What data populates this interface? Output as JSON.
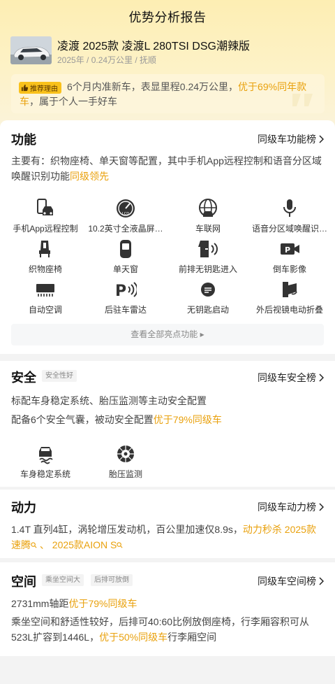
{
  "page": {
    "title": "优势分析报告"
  },
  "car": {
    "title": "凌渡 2025款 凌渡L 280TSI DSG潮辣版",
    "meta": "2025年 / 0.24万公里 / 抚顺"
  },
  "recommend": {
    "badge": "推荐理由",
    "text_1": "6个月内准新车，表显里程0.24万公里，",
    "highlight": "优于69%同年款车",
    "text_2": "，属于个人一手好车"
  },
  "features": {
    "title": "功能",
    "link": "同级车功能榜",
    "desc_1": "主要有：织物座椅、单天窗等配置，其中手机App远程控制和语音分区域唤醒识别功能",
    "desc_hl": "同级领先",
    "items": [
      {
        "label": "手机App远程控制",
        "icon": "phone-car-icon"
      },
      {
        "label": "10.2英寸全液晶屏…",
        "icon": "lcd-gauge-icon"
      },
      {
        "label": "车联网",
        "icon": "connected-car-icon"
      },
      {
        "label": "语音分区域唤醒识…",
        "icon": "microphone-icon"
      },
      {
        "label": "织物座椅",
        "icon": "seat-icon"
      },
      {
        "label": "单天窗",
        "icon": "sunroof-icon"
      },
      {
        "label": "前排无钥匙进入",
        "icon": "keyless-door-icon"
      },
      {
        "label": "倒车影像",
        "icon": "reverse-camera-icon"
      },
      {
        "label": "自动空调",
        "icon": "air-conditioner-icon"
      },
      {
        "label": "后驻车雷达",
        "icon": "parking-radar-icon"
      },
      {
        "label": "无钥匙启动",
        "icon": "keyless-start-icon"
      },
      {
        "label": "外后视镜电动折叠",
        "icon": "mirror-fold-icon"
      }
    ],
    "view_all": "查看全部亮点功能"
  },
  "safety": {
    "title": "安全",
    "tag": "安全性好",
    "link": "同级车安全榜",
    "line1": "标配车身稳定系统、胎压监测等主动安全配置",
    "line2_text": "配备6个安全气囊，被动安全配置",
    "line2_hl": "优于79%同级车",
    "items": [
      {
        "label": "车身稳定系统",
        "icon": "stability-control-icon"
      },
      {
        "label": "胎压监测",
        "icon": "tire-pressure-icon"
      }
    ]
  },
  "power": {
    "title": "动力",
    "link": "同级车动力榜",
    "text": "1.4T 直列4缸，涡轮增压发动机，百公里加速仅8.9s，",
    "hl_1": "动力秒杀 2025款速腾",
    "sep": " 、 ",
    "hl_2": "2025款AION S"
  },
  "space": {
    "title": "空间",
    "tags": [
      "乘坐空间大",
      "后排可放倒"
    ],
    "link": "同级车空间榜",
    "line1_text": "2731mm轴距",
    "line1_hl": "优于79%同级车",
    "line2_text": "乘坐空间和舒适性较好，后排可40:60比例放倒座椅，行李厢容积可从523L扩容到1446L，",
    "line2_hl": "优于50%同级车",
    "line2_tail": "行李厢空间"
  },
  "colors": {
    "accent": "#e9a10d",
    "badge": "#f9c11b"
  }
}
